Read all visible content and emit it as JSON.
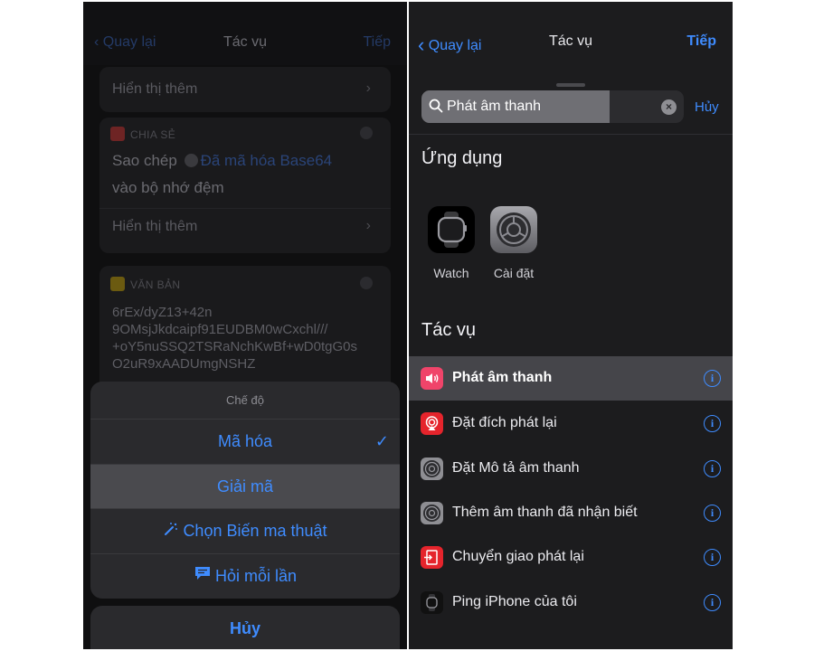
{
  "left": {
    "nav": {
      "back": "Quay lại",
      "title": "Tác vụ",
      "next": "Tiếp"
    },
    "background": {
      "show_more_1": "Hiển thị thêm",
      "share_header": "CHIA SẺ",
      "copy_text": "Sao chép",
      "base64_token": "Đã mã hóa Base64",
      "copy_text_2": "vào bộ nhớ đệm",
      "show_more_2": "Hiển thị thêm",
      "text_header": "VĂN BẢN",
      "text_lines": [
        "6rEx/dyZ13+42n",
        "9OMsjJkdcaipf91EUDBM0wCxchl///",
        "+oY5nuSSQ2TSRaNchKwBf+wD0tgG0s",
        "O2uR9xAADUmgNSHZ"
      ]
    },
    "sheet": {
      "title": "Chế độ",
      "options": [
        {
          "label": "Mã hóa",
          "checked": true
        },
        {
          "label": "Giải mã",
          "selected": true
        },
        {
          "label": "Chọn Biến ma thuật",
          "icon": "magic-wand-icon"
        },
        {
          "label": "Hỏi mỗi lần",
          "icon": "speech-bubble-icon"
        }
      ],
      "cancel": "Hủy"
    }
  },
  "right": {
    "nav": {
      "back": "Quay lại",
      "title": "Tác vụ",
      "next": "Tiếp"
    },
    "search": {
      "value": "Phát âm thanh",
      "cancel": "Hủy"
    },
    "apps_header": "Ứng dụng",
    "apps": [
      {
        "name": "Watch",
        "icon": "watch-app-icon"
      },
      {
        "name": "Cài đặt",
        "icon": "settings-gear-icon"
      }
    ],
    "actions_header": "Tác vụ",
    "actions": [
      {
        "label": "Phát âm thanh",
        "icon": "speaker-icon",
        "color": "#f0446a"
      },
      {
        "label": "Đặt đích phát lại",
        "icon": "airplay-icon",
        "color": "#e5242c"
      },
      {
        "label": "Đặt Mô tả âm thanh",
        "icon": "settings-gear-icon",
        "color": "#8e8e93"
      },
      {
        "label": "Thêm âm thanh đã nhận biết",
        "icon": "settings-gear-icon",
        "color": "#8e8e93"
      },
      {
        "label": "Chuyển giao phát lại",
        "icon": "handoff-icon",
        "color": "#e5242c"
      },
      {
        "label": "Ping iPhone của tôi",
        "icon": "watch-icon",
        "color": "#111111"
      }
    ]
  },
  "colors": {
    "accent": "#3f8cff",
    "background": "#1c1c1e",
    "sheet": "#2a2a2d"
  }
}
